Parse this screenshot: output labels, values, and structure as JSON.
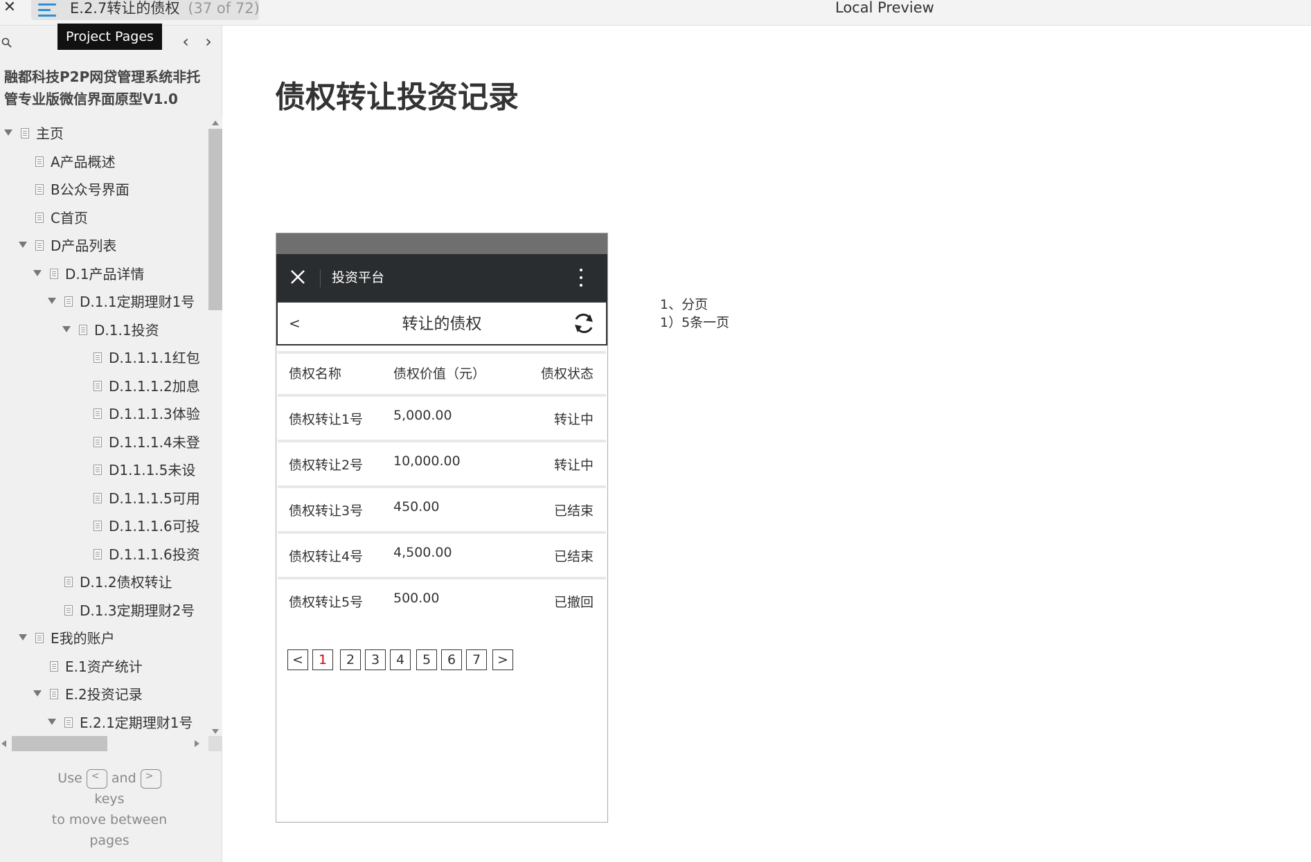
{
  "topbar": {
    "close_symbol": "✕",
    "page_title": "E.2.7转让的债权",
    "page_count": "(37 of 72)",
    "preview_label": "Local Preview"
  },
  "sidebar": {
    "tooltip": "Project Pages",
    "prev_symbol": "‹",
    "next_symbol": "›",
    "project_title": "融都科技P2P网贷管理系统非托管专业版微信界面原型V1.0",
    "tree": [
      {
        "label": "主页",
        "level": 0,
        "expanded": true
      },
      {
        "label": "A产品概述",
        "level": 1
      },
      {
        "label": "B公众号界面",
        "level": 1
      },
      {
        "label": "C首页",
        "level": 1
      },
      {
        "label": "D产品列表",
        "level": 1,
        "expanded": true
      },
      {
        "label": "D.1产品详情",
        "level": 2,
        "expanded": true
      },
      {
        "label": "D.1.1定期理财1号",
        "level": 3,
        "expanded": true
      },
      {
        "label": "D.1.1投资",
        "level": 4,
        "expanded": true
      },
      {
        "label": "D.1.1.1.1红包",
        "level": 5
      },
      {
        "label": "D.1.1.1.2加息",
        "level": 5
      },
      {
        "label": "D.1.1.1.3体验",
        "level": 5
      },
      {
        "label": "D.1.1.1.4未登",
        "level": 5
      },
      {
        "label": "D1.1.1.5未设",
        "level": 5
      },
      {
        "label": "D.1.1.1.5可用",
        "level": 5
      },
      {
        "label": "D.1.1.1.6可投",
        "level": 5
      },
      {
        "label": "D.1.1.1.6投资",
        "level": 5
      },
      {
        "label": "D.1.2债权转让",
        "level": 3
      },
      {
        "label": "D.1.3定期理财2号",
        "level": 3
      },
      {
        "label": "E我的账户",
        "level": 1,
        "expanded": true
      },
      {
        "label": "E.1资产统计",
        "level": 2
      },
      {
        "label": "E.2投资记录",
        "level": 2,
        "expanded": true
      },
      {
        "label": "E.2.1定期理财1号",
        "level": 3,
        "expanded": true
      }
    ],
    "help": {
      "use": "Use",
      "key_prev": "<",
      "and": "and",
      "key_next": ">",
      "keys": "keys",
      "line2": "to move between",
      "line3": "pages"
    }
  },
  "main": {
    "heading": "债权转让投资记录",
    "notes": [
      "1、分页",
      "1）5条一页"
    ]
  },
  "phone": {
    "nav_title": "投资平台",
    "back_label": "<",
    "header_title": "转让的债权",
    "table": {
      "headers": {
        "name": "债权名称",
        "value": "债权价值（元）",
        "status": "债权状态"
      },
      "rows": [
        {
          "name": "债权转让1号",
          "value": "5,000.00",
          "status": "转让中"
        },
        {
          "name": "债权转让2号",
          "value": "10,000.00",
          "status": "转让中"
        },
        {
          "name": "债权转让3号",
          "value": "450.00",
          "status": "已结束"
        },
        {
          "name": "债权转让4号",
          "value": "4,500.00",
          "status": "已结束"
        },
        {
          "name": "债权转让5号",
          "value": "500.00",
          "status": "已撤回"
        }
      ]
    },
    "pagination": {
      "prev": "<",
      "pages": [
        "1",
        "2",
        "3",
        "4",
        "5",
        "6",
        "7"
      ],
      "next": ">",
      "current": "1",
      "current_color": "#cc0000"
    }
  },
  "colors": {
    "accent": "#2a8fd6",
    "nav_bar": "#2a2d2f",
    "status_bar": "#6f6f6f"
  }
}
